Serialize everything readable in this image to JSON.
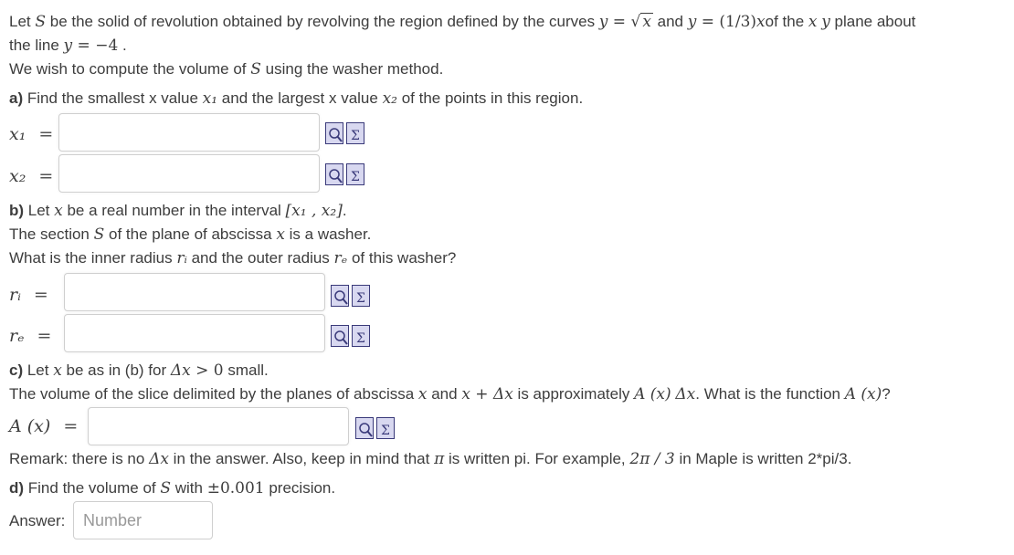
{
  "intro": {
    "l1_a": "Let ",
    "S": "S",
    "l1_b": " be the solid of revolution obtained by revolving the region defined by the curves ",
    "y": "y",
    "eq": " = ",
    "x": "x",
    "and": " and ",
    "frac": "(1/3)",
    "of_the": "of the ",
    "plane_about": " plane about",
    "l2_a": "the line ",
    "l2_val": "−4",
    "l2_b": " .",
    "l3_a": "We wish to compute the volume of ",
    "l3_b": " using the washer method."
  },
  "part_a": {
    "tag": "a)",
    "text_a": " Find the smallest x value ",
    "x1": "x₁",
    "text_b": " and the largest x value ",
    "x2": "x₂",
    "text_c": " of the points in this region.",
    "label_x1": "x₁",
    "label_x2": "x₂",
    "equals": "="
  },
  "part_b": {
    "tag": "b)",
    "l1_a": " Let ",
    "l1_b": " be a real number in the interval ",
    "interval": "[x₁ , x₂]",
    "l1_c": ".",
    "l2_a": "The section ",
    "l2_b": " of the plane of abscissa ",
    "l2_c": " is a washer.",
    "l3_a": "What is the inner radius ",
    "ri": "rᵢ",
    "l3_b": " and the outer radius ",
    "re": "rₑ",
    "l3_c": " of this washer?",
    "label_ri": "rᵢ",
    "label_re": "rₑ"
  },
  "part_c": {
    "tag": "c)",
    "l1_a": " Let ",
    "l1_b": " be as in (b) for ",
    "dx": "Δx",
    "gt0": " > 0",
    "l1_c": " small.",
    "l2_a": "The volume of the slice delimited by the planes of abscissa ",
    "l2_and": " and ",
    "xdx": "x + Δx",
    "l2_b": " is approximately ",
    "Ax": "A (x)",
    "l2_c": ". What is the function ",
    "l2_d": "?",
    "label_Ax": "A (x)"
  },
  "remark": {
    "a": "Remark: there is no ",
    "b": " in the answer. Also, keep in mind that ",
    "pi": "π",
    "c": " is written pi. For example, ",
    "expr": "2π / 3",
    "d": " in Maple is written 2*pi/3."
  },
  "part_d": {
    "tag": "d)",
    "a": " Find the volume of ",
    "b": " with ",
    "prec": "±0.001",
    "c": " precision.",
    "answer_label": "Answer:",
    "placeholder": "Number"
  },
  "icons": [
    "preview-icon",
    "equation-editor-icon"
  ],
  "colors": {
    "text": "#3d3d3d",
    "icon_border": "#3a3a7a",
    "icon_fill": "#d8d8f0"
  }
}
